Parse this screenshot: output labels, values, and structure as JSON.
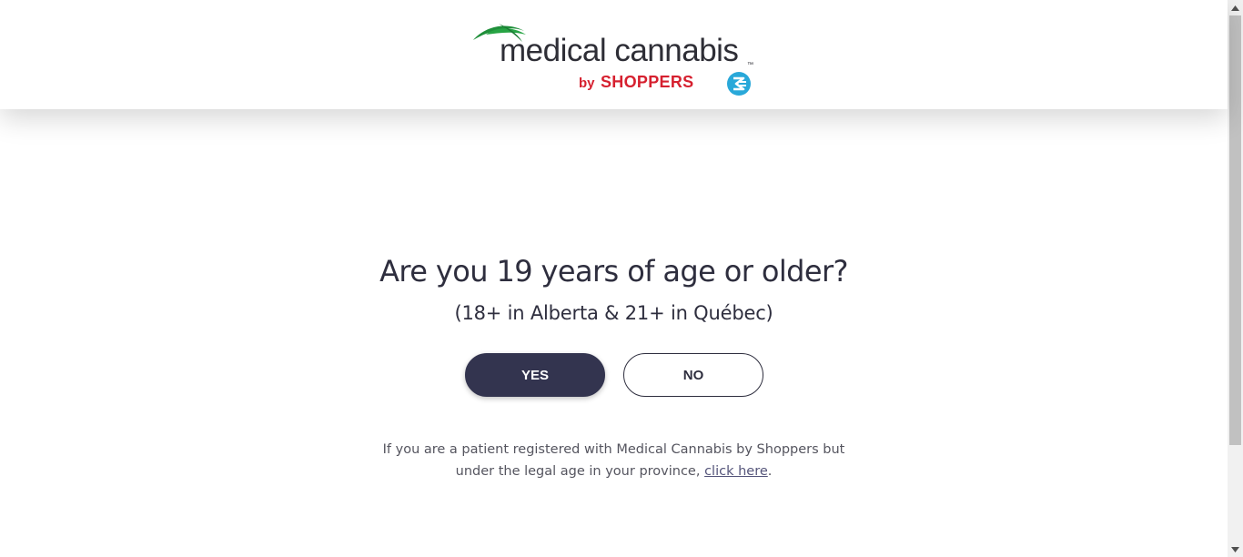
{
  "header": {
    "logo": {
      "primary_text": "medical cannabis",
      "by_text": "by",
      "store_text": "SHOPPERS",
      "tm": "™",
      "colors": {
        "leaf": "#1f8f3a",
        "text": "#2e2e36",
        "red": "#d6202f",
        "blue": "#29a8d9"
      }
    }
  },
  "age_gate": {
    "question": "Are you 19 years of age or older?",
    "subnote": "(18+ in Alberta & 21+ in Québec)",
    "yes_label": "YES",
    "no_label": "NO",
    "notice_line1": "If you are a patient registered with Medical Cannabis by Shoppers but",
    "notice_line2_prefix": "under the legal age in your province, ",
    "notice_link": "click here",
    "notice_suffix": "."
  },
  "colors": {
    "button_primary": "#33344f",
    "text": "#2e2e3e"
  }
}
